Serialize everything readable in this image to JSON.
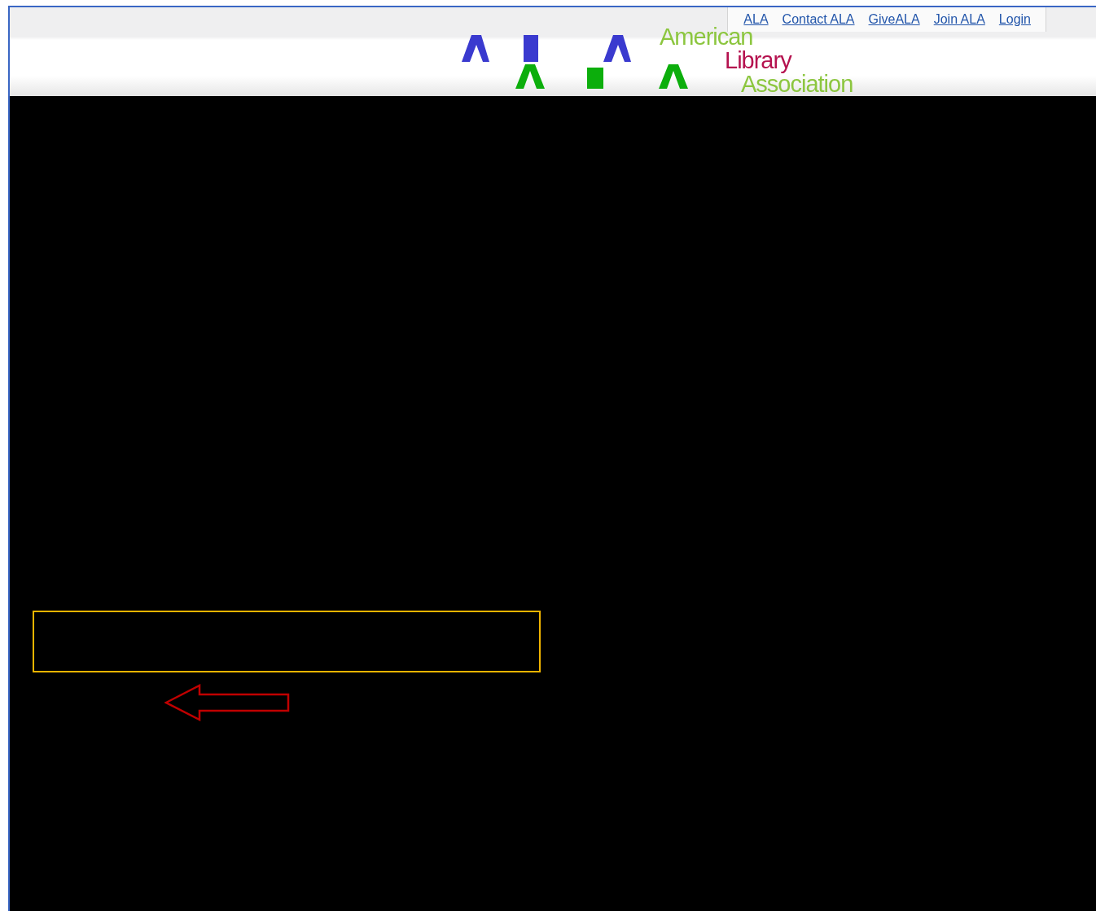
{
  "top_links": [
    {
      "label": "ALA"
    },
    {
      "label": "Contact ALA"
    },
    {
      "label": "GiveALA"
    },
    {
      "label": "Join ALA"
    },
    {
      "label": "Login"
    }
  ],
  "logo": {
    "lines": [
      {
        "text": "American",
        "color": "#8cc63f"
      },
      {
        "text": "Library",
        "color": "#b5124f"
      },
      {
        "text": "Association",
        "color": "#8cc63f"
      }
    ]
  }
}
